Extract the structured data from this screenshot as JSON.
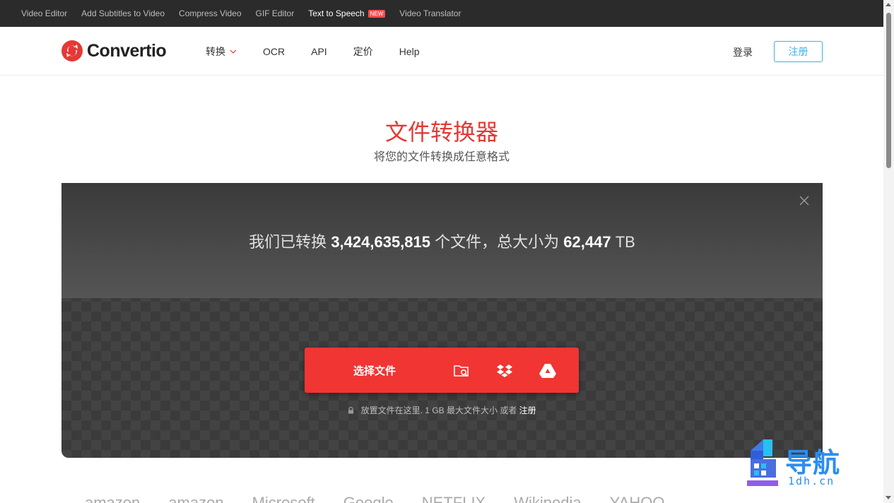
{
  "topbar": {
    "links": [
      "Video Editor",
      "Add Subtitles to Video",
      "Compress Video",
      "GIF Editor",
      "Text to Speech",
      "Video Translator"
    ],
    "new_badge": "NEW"
  },
  "header": {
    "logo": "Convertio",
    "nav": [
      "转换",
      "OCR",
      "API",
      "定价",
      "Help"
    ],
    "login": "登录",
    "register": "注册"
  },
  "hero": {
    "title": "文件转换器",
    "subtitle": "将您的文件转换成任意格式"
  },
  "panel": {
    "stats_prefix": "我们已转换",
    "files_count": "3,424,635,815",
    "stats_middle": "个文件，总大小为",
    "total_size": "62,447",
    "unit": "TB",
    "choose_label": "选择文件",
    "drop_text": "放置文件在这里. 1 GB 最大文件大小 或者",
    "drop_register": "注册"
  },
  "watermark": {
    "text": "导航",
    "url": "1dh.cn"
  },
  "partner_logos": [
    "amazon",
    "amazon",
    "Microsoft",
    "Google",
    "NETFLIX",
    "Wikipedia",
    "YAHOO"
  ],
  "colors": {
    "accent": "#f13533",
    "title": "#e53935",
    "register": "#3ab4e6",
    "topbar": "#2b2b2b"
  }
}
